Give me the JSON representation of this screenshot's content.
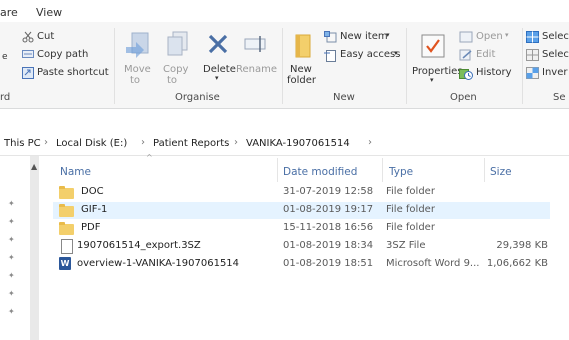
{
  "tabs": [
    "are",
    "View"
  ],
  "ribbon": {
    "clipboard": {
      "cut": "Cut",
      "copy_path": "Copy path",
      "paste_shortcut": "Paste shortcut"
    },
    "clipboard_group_partial": "rd",
    "organise": {
      "move_to": [
        "Move",
        "to"
      ],
      "copy_to": [
        "Copy",
        "to"
      ],
      "delete": "Delete",
      "rename": "Rename",
      "label": "Organise"
    },
    "new": {
      "new_folder": [
        "New",
        "folder"
      ],
      "new_item": "New item",
      "easy_access": "Easy access",
      "label": "New"
    },
    "open": {
      "properties": "Properties",
      "open": "Open",
      "edit": "Edit",
      "history": "History",
      "label": "Open"
    },
    "select": {
      "select_all_partial": "Selec",
      "select_none_partial": "Selec",
      "invert_partial": "Inver",
      "label_partial": "Se"
    }
  },
  "breadcrumb": [
    "This PC",
    "Local Disk (E:)",
    "Patient Reports",
    "VANIKA-1907061514"
  ],
  "columns": {
    "name": "Name",
    "date": "Date modified",
    "type": "Type",
    "size": "Size"
  },
  "files": [
    {
      "name": "DOC",
      "date": "31-07-2019 12:58",
      "type": "File folder",
      "size": "",
      "icon": "folder-icon",
      "selected": false
    },
    {
      "name": "GIF-1",
      "date": "01-08-2019 19:17",
      "type": "File folder",
      "size": "",
      "icon": "folder-icon",
      "selected": true
    },
    {
      "name": "PDF",
      "date": "15-11-2018 16:56",
      "type": "File folder",
      "size": "",
      "icon": "folder-icon",
      "selected": false
    },
    {
      "name": "1907061514_export.3SZ",
      "date": "01-08-2019 18:34",
      "type": "3SZ File",
      "size": "29,398 KB",
      "icon": "file-icon",
      "selected": false
    },
    {
      "name": "overview-1-VANIKA-1907061514",
      "date": "01-08-2019 18:51",
      "type": "Microsoft Word 9...",
      "size": "1,06,662 KB",
      "icon": "word-doc-icon",
      "selected": false
    }
  ],
  "colors": {
    "selection": "#e5f3ff",
    "folder": "#f3cf6b",
    "column_header": "#4a6fa5",
    "word_blue": "#2b579a"
  }
}
